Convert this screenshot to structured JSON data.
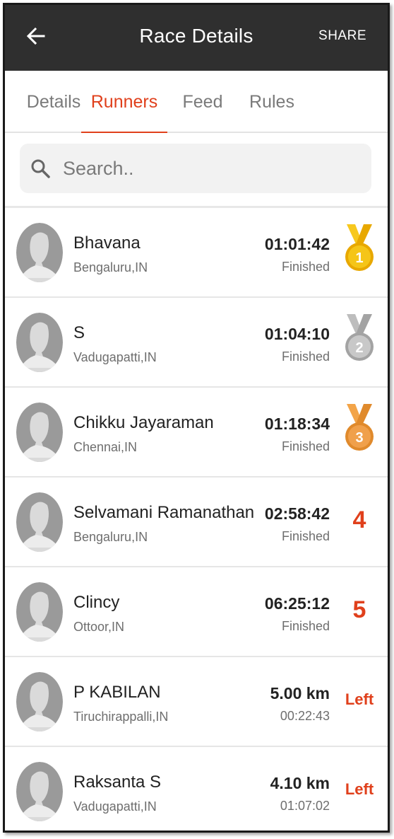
{
  "appbar": {
    "title": "Race Details",
    "share_label": "SHARE",
    "back_icon": "arrow-left-icon"
  },
  "tabs": [
    {
      "label": "Details",
      "active": false
    },
    {
      "label": "Runners",
      "active": true
    },
    {
      "label": "Feed",
      "active": false
    },
    {
      "label": "Rules",
      "active": false
    }
  ],
  "search": {
    "placeholder": "Search..",
    "icon": "search-icon"
  },
  "colors": {
    "accent": "#e0401c",
    "appbar_bg": "#2f2f2f",
    "gold": "#f5c518",
    "silver": "#b8b8b8",
    "bronze": "#f0a04b"
  },
  "runners": [
    {
      "name": "Bhavana",
      "location": "Bengaluru,IN",
      "value": "01:01:42",
      "status": "Finished",
      "rank": "1",
      "rank_type": "gold-medal"
    },
    {
      "name": "S",
      "location": "Vadugapatti,IN",
      "value": "01:04:10",
      "status": "Finished",
      "rank": "2",
      "rank_type": "silver-medal"
    },
    {
      "name": "Chikku Jayaraman",
      "location": "Chennai,IN",
      "value": "01:18:34",
      "status": "Finished",
      "rank": "3",
      "rank_type": "bronze-medal"
    },
    {
      "name": "Selvamani Ramanathan",
      "location": "Bengaluru,IN",
      "value": "02:58:42",
      "status": "Finished",
      "rank": "4",
      "rank_type": "number"
    },
    {
      "name": "Clincy",
      "location": "Ottoor,IN",
      "value": "06:25:12",
      "status": "Finished",
      "rank": "5",
      "rank_type": "number"
    },
    {
      "name": "P KABILAN",
      "location": "Tiruchirappalli,IN",
      "value": "5.00 km",
      "status": "00:22:43",
      "rank": "Left",
      "rank_type": "left"
    },
    {
      "name": "Raksanta S",
      "location": "Vadugapatti,IN",
      "value": "4.10 km",
      "status": "01:07:02",
      "rank": "Left",
      "rank_type": "left"
    }
  ]
}
